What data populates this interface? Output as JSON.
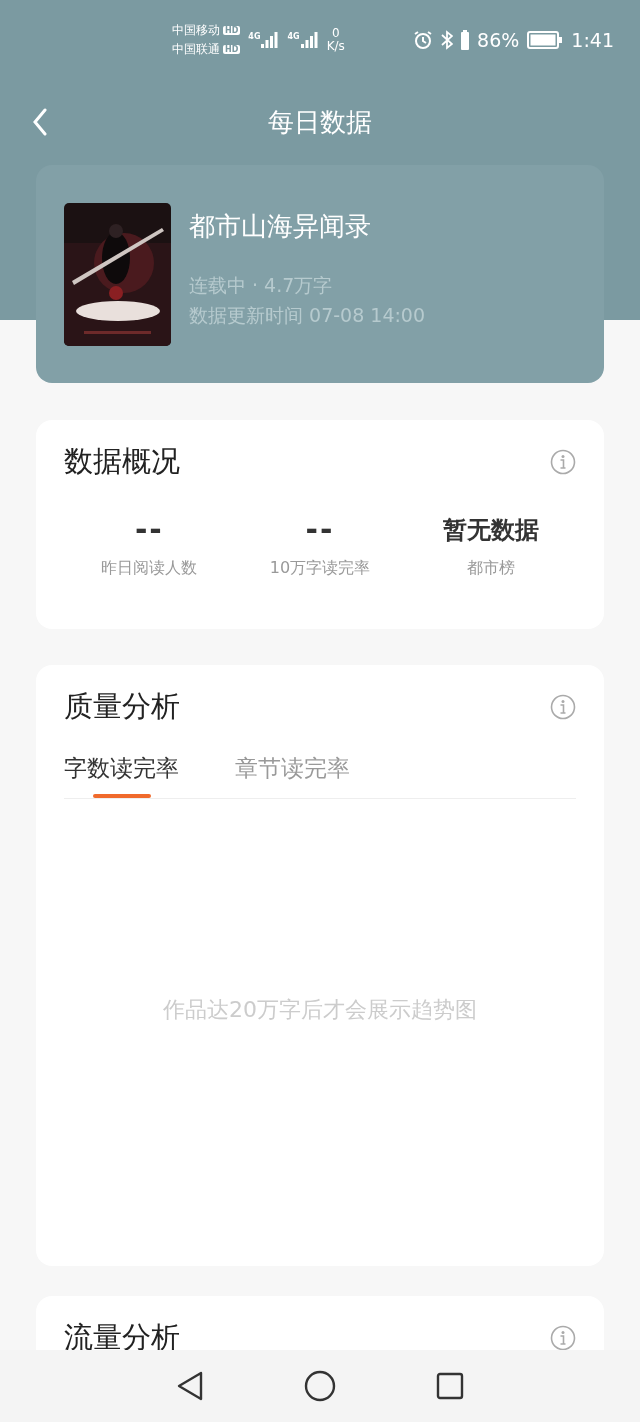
{
  "status_bar": {
    "carriers": [
      {
        "name": "中国移动",
        "badge": "HD"
      },
      {
        "name": "中国联通",
        "badge": "HD"
      }
    ],
    "network": [
      "4G",
      "4G"
    ],
    "speed_value": "0",
    "speed_unit": "K/s",
    "battery": "86%",
    "time": "1:41"
  },
  "header": {
    "title": "每日数据"
  },
  "book": {
    "title": "都市山海异闻录",
    "meta": "连载中 · 4.7万字",
    "updated": "数据更新时间 07-08 14:00"
  },
  "overview": {
    "title": "数据概况",
    "stats": [
      {
        "kind": "dash",
        "value": "--",
        "label": "昨日阅读人数"
      },
      {
        "kind": "dash",
        "value": "--",
        "label": "10万字读完率"
      },
      {
        "kind": "text",
        "value": "暂无数据",
        "label": "都市榜"
      }
    ]
  },
  "quality": {
    "title": "质量分析",
    "tabs": [
      {
        "label": "字数读完率",
        "selected": true
      },
      {
        "label": "章节读完率",
        "selected": false
      }
    ],
    "empty_message": "作品达20万字后才会展示趋势图"
  },
  "traffic": {
    "title": "流量分析"
  }
}
